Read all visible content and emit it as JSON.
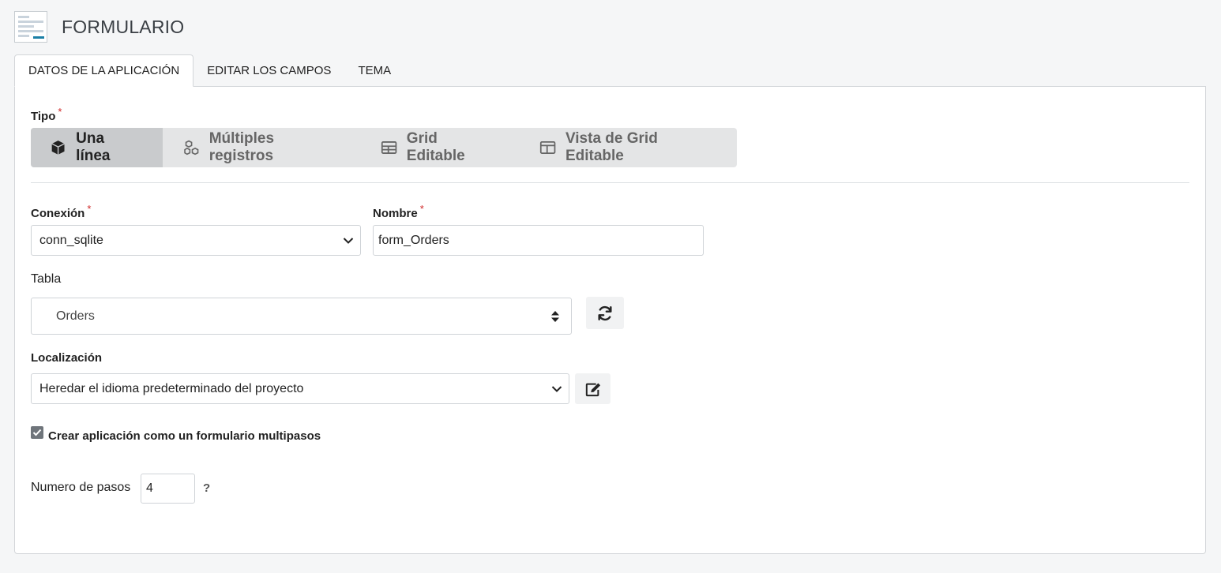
{
  "header": {
    "title": "FORMULARIO",
    "icon": "form-document-icon"
  },
  "tabs": [
    {
      "label": "DATOS DE LA APLICACIÓN",
      "active": true
    },
    {
      "label": "EDITAR LOS CAMPOS",
      "active": false
    },
    {
      "label": "TEMA",
      "active": false
    }
  ],
  "tipo": {
    "label": "Tipo",
    "required_mark": "*",
    "options": [
      {
        "label": "Una línea",
        "icon": "cube-icon",
        "active": true
      },
      {
        "label": "Múltiples registros",
        "icon": "cubes-icon",
        "active": false
      },
      {
        "label": "Grid Editable",
        "icon": "table-grid-icon",
        "active": false
      },
      {
        "label": "Vista de Grid Editable",
        "icon": "columns-icon",
        "active": false
      }
    ]
  },
  "conexion": {
    "label": "Conexión",
    "required_mark": "*",
    "value": "conn_sqlite"
  },
  "nombre": {
    "label": "Nombre",
    "required_mark": "*",
    "value": "form_Orders"
  },
  "tabla": {
    "label": "Tabla",
    "value": "Orders",
    "refresh_icon": "refresh-icon"
  },
  "localizacion": {
    "label": "Localización",
    "value": "Heredar el idioma predeterminado del proyecto",
    "edit_icon": "edit-icon"
  },
  "multistep": {
    "label": "Crear aplicación como un formulario multipasos",
    "checked": true
  },
  "pasos": {
    "label": "Numero de pasos",
    "value": "4",
    "help": "?"
  },
  "colors": {
    "accent": "#1b7fa6",
    "required": "#d02a2a",
    "segment_active": "#c9cbcd",
    "segment_bg": "#e4e5e6"
  }
}
